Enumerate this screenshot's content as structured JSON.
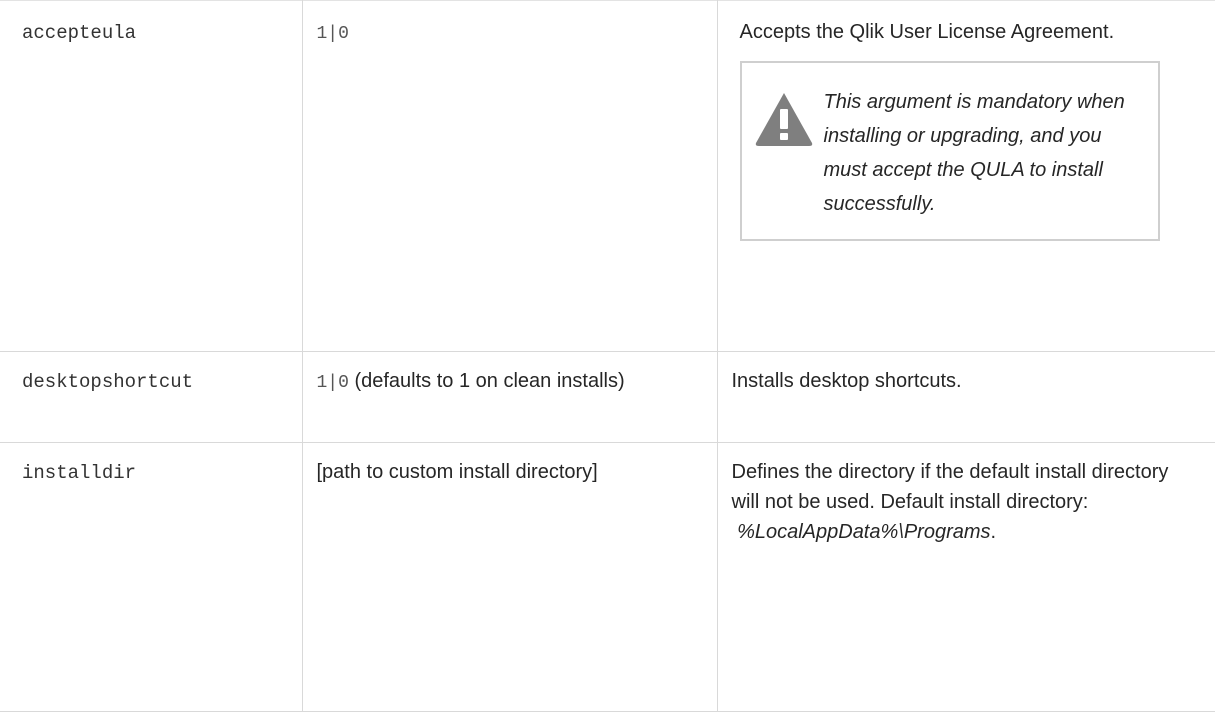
{
  "rows": [
    {
      "argument": "accepteula",
      "value_code": "1|0",
      "value_text": "",
      "description": "Accepts the Qlik User License Agreement.",
      "note": "This argument is mandatory when installing or upgrading, and you must accept the QULA to install successfully.",
      "note_icon": "warning-icon"
    },
    {
      "argument": "desktopshortcut",
      "value_code": "1|0",
      "value_text": " (defaults to 1 on clean installs)",
      "description": "Installs desktop shortcuts."
    },
    {
      "argument": "installdir",
      "value_code": "",
      "value_text": "[path to custom install directory]",
      "description": "Defines the directory if the default install directory will not be used. Default install directory:",
      "description_path": "%LocalAppData%\\Programs",
      "description_suffix": "."
    }
  ],
  "colors": {
    "border": "#d9d9d9",
    "note_border": "#cfcfcf",
    "icon": "#7f7f7f",
    "text": "#262626"
  }
}
